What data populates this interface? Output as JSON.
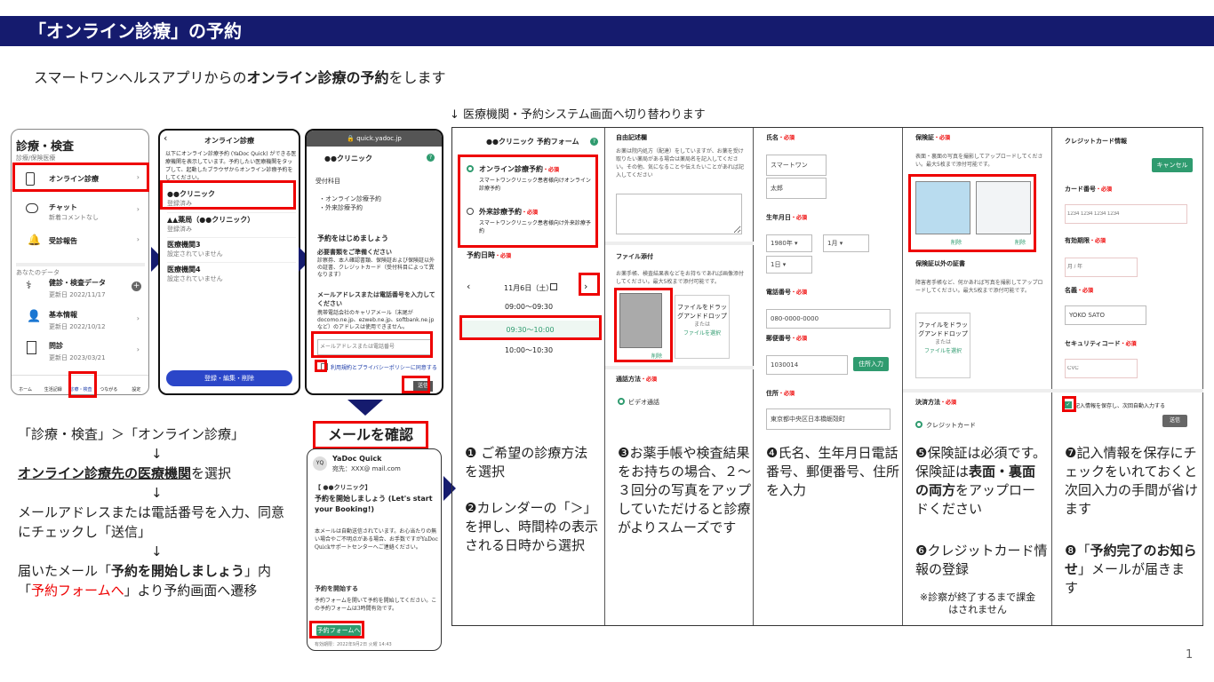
{
  "header": {
    "title": "「オンライン診療」の予約"
  },
  "subtitle": {
    "prefix": "スマートワンヘルスアプリからの",
    "bold": "オンライン診療の予約",
    "suffix": "をします"
  },
  "note_top": "↓ 医療機関・予約システム画面へ切り替わります",
  "phone1": {
    "title": "診療・検査",
    "sub": "診療/保険医療",
    "items": [
      "オンライン診療",
      "チャット",
      "受診報告"
    ],
    "chat_sub": "新着コメントなし",
    "section2": "あなたのデータ",
    "data_items": [
      {
        "label": "健診・検査データ",
        "date": "更新日 2022/11/17"
      },
      {
        "label": "基本情報",
        "date": "更新日 2022/10/12"
      },
      {
        "label": "問診",
        "date": "更新日 2023/03/21"
      }
    ],
    "nav": [
      "ホーム",
      "生活記録",
      "診療・検査",
      "つながる",
      "設定"
    ]
  },
  "phone2": {
    "title": "オンライン診療",
    "intro": "以下にオンライン診療予約 (YaDoc Quick) ができる医療機関を表示しています。予約したい医療機関をタップして、起動したブラウザからオンライン診療予約をしてください。",
    "items": [
      {
        "name": "●●クリニック",
        "sub": "登録済み"
      },
      {
        "name": "▲▲薬局（●●クリニック）",
        "sub": "登録済み"
      },
      {
        "name": "医療機関3",
        "sub": "設定されていません"
      },
      {
        "name": "医療機関4",
        "sub": "設定されていません"
      }
    ],
    "button": "登録・編集・削除"
  },
  "phone3": {
    "url": "quick.yadoc.jp",
    "clinic": "●●クリニック",
    "dept_label": "受付科目",
    "depts": [
      "・オンライン診療予約",
      "・外来診療予約"
    ],
    "heading": "予約をはじめましょう",
    "need": "必要書類をご準備ください",
    "need_text": "診察券、本人確認書類、保険証および保険証以外の証書、クレジットカード（受付科目によって異なります）",
    "mail_head": "メールアドレスまたは電話番号を入力してください",
    "mail_text": "携帯電話会社のキャリアメール（末尾が docomo.ne.jp、ezweb.ne.jp、softbank.ne.jp など）のアドレスは使用できません。",
    "placeholder": "メールアドレスまたは電話番号",
    "agree": "利用規約とプライバシーポリシーに同意する",
    "send": "送信"
  },
  "mail": {
    "label": "メールを確認",
    "from": "YaDoc Quick",
    "to": "宛先：XXX@ mail.com",
    "clinic": "【 ●●クリニック】",
    "subject": "予約を開始しましょう (Let's start your Booking!)",
    "body": "本メールは自動送信されています。お心当たりの無い場合やご不明点がある場合、お手数ですがYaDoc Quickサポートセンターへご連絡ください。",
    "start_head": "予約を開始する",
    "start_text": "予約フォームを開いて予約を開始してください。この予約フォームは3時間有効です。",
    "button": "予約フォームへ",
    "footer": "有効期限：2022年9月2日 火曜 14:43"
  },
  "left_steps": {
    "line1": "「診療・検査」＞「オンライン診療」",
    "arrow": "↓",
    "line2_bold": "オンライン診療先の医療機関",
    "line2_suffix": "を選択",
    "line3": "メールアドレスまたは電話番号を入力、同意にチェックし「送信」",
    "line4_prefix": "届いたメール「",
    "line4_bold": "予約を開始しましょう",
    "line4_mid": "」内「",
    "line4_red": "予約フォームへ",
    "line4_suffix": "」より予約画面へ遷移"
  },
  "col1": {
    "title": "●●クリニック 予約フォーム",
    "opt1": "オンライン診療予約",
    "opt1_sub": "スマートワンクリニック患者様向けオンライン診療予約",
    "opt2": "外来診療予約",
    "opt2_sub": "スマートワンクリニック患者様向け外来診療予約",
    "date_label": "予約日時",
    "date": "11月6日（土）",
    "times": [
      "09:00〜09:30",
      "09:30〜10:00",
      "10:00〜10:30"
    ],
    "desc1": "❶ ご希望の診療方法を選択",
    "desc2": "❷カレンダーの「＞」を押し、時間枠の表示される日時から選択"
  },
  "col2": {
    "free_label": "自由記述欄",
    "free_text": "お薬は院内処方（配達）をしていますが、お薬を受け取りたい薬局がある場合は薬局名を記入してください。その他、気になることや伝えたいことがあれば記入してください",
    "file_label": "ファイル添付",
    "file_text": "お薬手帳、検査結果表などをお持ちであれば画像添付してください。最大5枚まで添付可能です。",
    "drop": "ファイルをドラッグアンドドロップ",
    "or": "または",
    "select": "ファイルを選択",
    "delete": "削除",
    "call_label": "通話方法",
    "call": "ビデオ通話",
    "desc": "❸お薬手帳や検査結果をお持ちの場合、２〜３回分の写真をアップしていただけると診療がよりスムーズです"
  },
  "col3": {
    "name_label": "氏名",
    "last": "スマートワン",
    "first": "太郎",
    "birth_label": "生年月日",
    "year": "1980年",
    "month": "1月",
    "day": "1日",
    "phone_label": "電話番号",
    "phone": "080-0000-0000",
    "zip_label": "郵便番号",
    "zip": "1030014",
    "zip_btn": "住所入力",
    "addr_label": "住所",
    "addr": "東京都中央区日本橋蛎殻町",
    "desc": "❹氏名、生年月日電話番号、郵便番号、住所を入力"
  },
  "col4": {
    "ins_label": "保険証",
    "ins_text": "表面・裏面の写真を撮影してアップロードしてください。最大5枚まで添付可能です。",
    "delete": "削除",
    "other_label": "保険証以外の証書",
    "other_text": "障害者手帳など、何かあれば写真を撮影してアップロードしてください。最大5枚まで添付可能です。",
    "drop": "ファイルをドラッグアンドドロップ",
    "or": "または",
    "select": "ファイルを選択",
    "pay_label": "決済方法",
    "pay": "クレジットカード",
    "desc1_a": "❺保険証は必須です。保険証は",
    "desc1_b": "表面・裏面の両方",
    "desc1_c": "をアップロードください",
    "desc2": "❻クレジットカード情報の登録",
    "note": "※診察が終了するまで課金はされません"
  },
  "col5": {
    "cc_label": "クレジットカード情報",
    "cancel": "キャンセル",
    "num_label": "カード番号",
    "num_ph": "1234 1234 1234 1234",
    "exp_label": "有効期限",
    "exp_ph": "月 / 年",
    "name_label": "名義",
    "name": "YOKO SATO",
    "sec_label": "セキュリティコード",
    "sec_ph": "CVC",
    "save": "記入情報を保存し、次回自動入力する",
    "send": "送信",
    "desc1": "❼記入情報を保存にチェックをいれておくと次回入力の手間が省けます",
    "desc2_a": "❽「",
    "desc2_b": "予約完了のお知らせ",
    "desc2_c": "」メールが届きます"
  },
  "required": "・必須",
  "page_number": "1",
  "colors": {
    "navy": "#151b6e",
    "red": "#e00000",
    "green": "#2f9b6f"
  }
}
